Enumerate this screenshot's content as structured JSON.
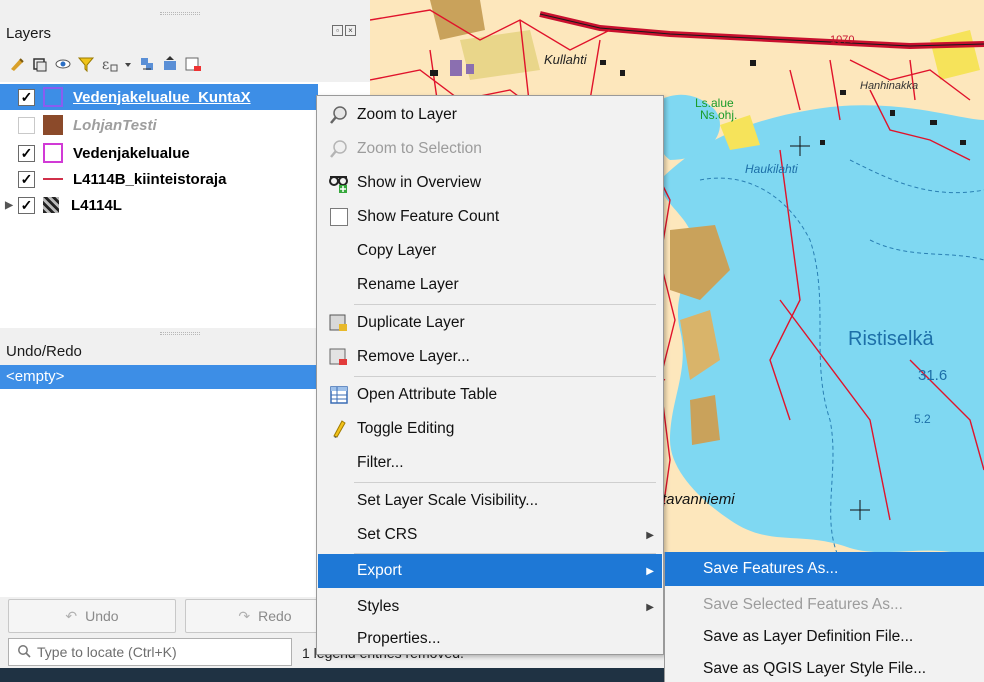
{
  "layers_panel": {
    "title": "Layers",
    "dock_buttons": [
      "float",
      "close"
    ],
    "toolbar_icons": [
      "style-manager-icon",
      "add-group-icon",
      "visibility-icon",
      "filter-legend-icon",
      "filter-expression-icon",
      "dropdown-icon",
      "expand-all-icon",
      "collapse-all-icon",
      "remove-layer-icon"
    ],
    "layers": [
      {
        "name": "Vedenjakelualue_KuntaX",
        "checked": true,
        "selected": true,
        "symbol": "polygon-purple-outline",
        "color": "#8a5cf0"
      },
      {
        "name": "LohjanTesti",
        "checked": false,
        "selected": false,
        "symbol": "polygon-brown-fill",
        "color": "#8b4a2a"
      },
      {
        "name": "Vedenjakelualue",
        "checked": true,
        "selected": false,
        "symbol": "polygon-magenta-outline",
        "color": "#d13ad6"
      },
      {
        "name": "L4114B_kiinteistoraja",
        "checked": true,
        "selected": false,
        "symbol": "line-red",
        "color": "#d1304a"
      },
      {
        "name": "L4114L",
        "checked": true,
        "selected": false,
        "symbol": "raster",
        "color": "#333333"
      }
    ]
  },
  "undo_panel": {
    "title": "Undo/Redo",
    "empty_label": "<empty>",
    "undo_label": "Undo",
    "redo_label": "Redo"
  },
  "statusbar": {
    "search_placeholder": "Type to locate (Ctrl+K)",
    "message": "1 legend entries removed."
  },
  "context_menu": {
    "items": [
      {
        "label": "Zoom to Layer",
        "icon": "zoom-layer-icon",
        "enabled": true
      },
      {
        "label": "Zoom to Selection",
        "icon": "zoom-selection-icon",
        "enabled": false
      },
      {
        "label": "Show in Overview",
        "icon": "overview-icon",
        "enabled": true
      },
      {
        "label": "Show Feature Count",
        "icon": "checkbox-icon",
        "enabled": true
      },
      {
        "label": "Copy Layer",
        "icon": "",
        "enabled": true
      },
      {
        "label": "Rename Layer",
        "icon": "",
        "enabled": true
      },
      {
        "label": "Duplicate Layer",
        "icon": "duplicate-layer-icon",
        "enabled": true
      },
      {
        "label": "Remove Layer...",
        "icon": "remove-layer-icon",
        "enabled": true
      },
      {
        "label": "Open Attribute Table",
        "icon": "attribute-table-icon",
        "enabled": true
      },
      {
        "label": "Toggle Editing",
        "icon": "pencil-icon",
        "enabled": true
      },
      {
        "label": "Filter...",
        "icon": "",
        "enabled": true
      },
      {
        "label": "Set Layer Scale Visibility...",
        "icon": "",
        "enabled": true
      },
      {
        "label": "Set CRS",
        "icon": "",
        "enabled": true,
        "submenu": true
      },
      {
        "label": "Export",
        "icon": "",
        "enabled": true,
        "submenu": true,
        "highlighted": true
      },
      {
        "label": "Styles",
        "icon": "",
        "enabled": true,
        "submenu": true
      },
      {
        "label": "Properties...",
        "icon": "",
        "enabled": true
      }
    ]
  },
  "export_submenu": {
    "items": [
      {
        "label": "Save Features As...",
        "highlighted": true,
        "enabled": true
      },
      {
        "label": "Save Selected Features As...",
        "enabled": false
      },
      {
        "label": "Save as Layer Definition File...",
        "enabled": true
      },
      {
        "label": "Save as QGIS Layer Style File...",
        "enabled": true
      }
    ]
  },
  "map": {
    "labels": [
      "Kullahti",
      "Ls.alue",
      "Ns.ohj.",
      "Hanhinakka",
      "Haukilahti",
      "Ristiselkä",
      "31.6",
      "5.2",
      "tavanniemi",
      "1070"
    ],
    "colors": {
      "water": "#7fd8f2",
      "land": "#fde7bc",
      "parcel": "#e0132b",
      "road": "#c8102e",
      "field": "#f6e35a",
      "built": "#c9a25b"
    }
  },
  "theme": {
    "selection": "#3d8ee6",
    "menu_highlight": "#1e78d6"
  }
}
